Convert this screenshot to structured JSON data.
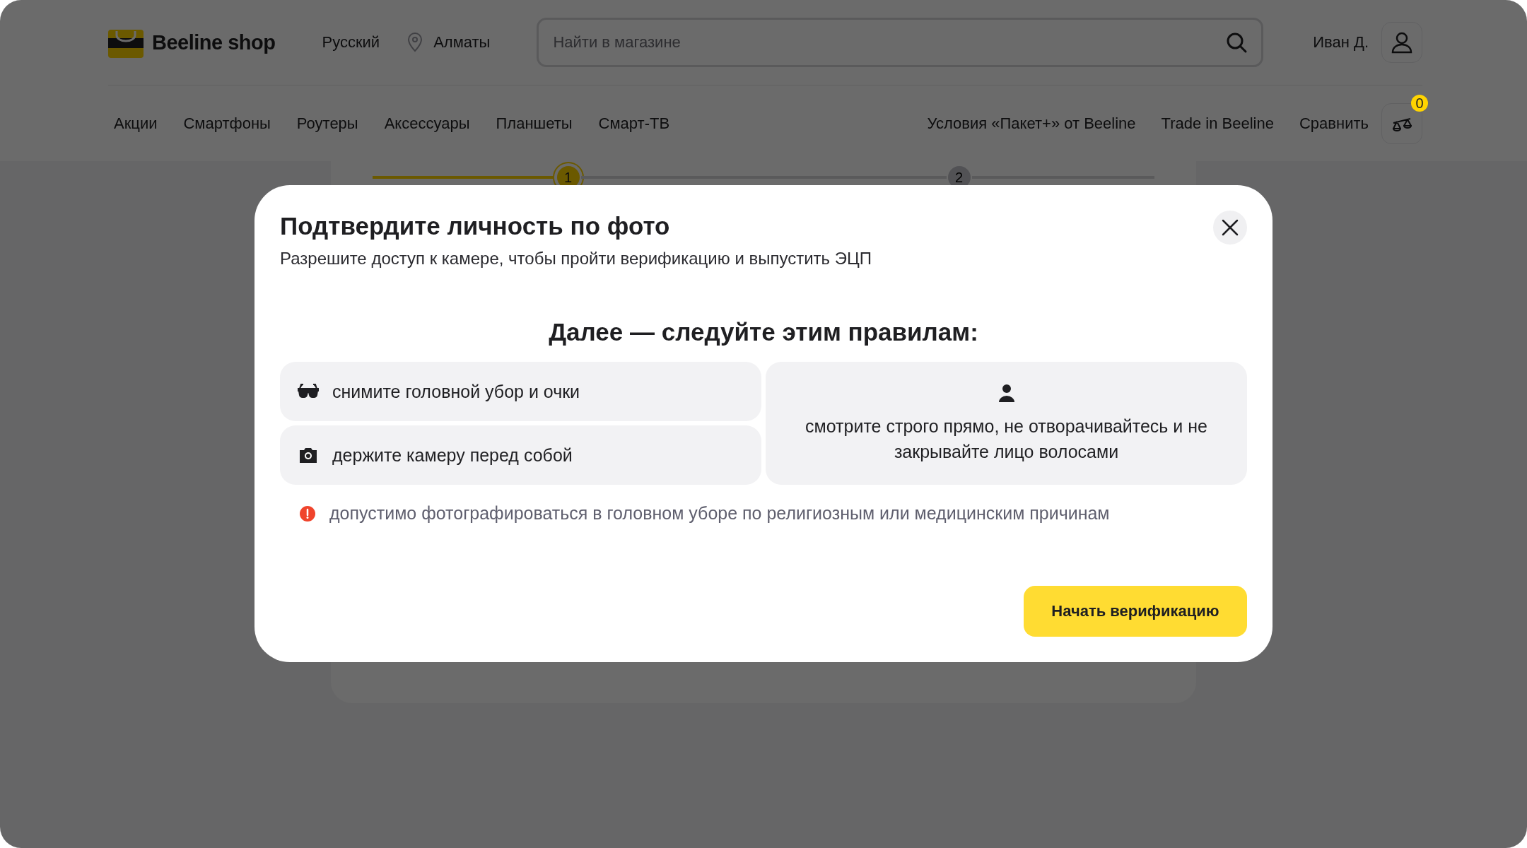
{
  "header": {
    "logo": "Beeline shop",
    "language": "Русский",
    "city": "Алматы",
    "search": {
      "placeholder": "Найти в магазине"
    },
    "user": "Иван Д."
  },
  "nav": {
    "items": [
      "Акции",
      "Смартфоны",
      "Роутеры",
      "Аксессуары",
      "Планшеты",
      "Смарт-ТВ"
    ],
    "right_items": [
      "Условия «Пакет+» от Beeline",
      "Trade in Beeline",
      "Сравнить"
    ],
    "compare_count": "0"
  },
  "stepper": {
    "steps": [
      {
        "label": "1",
        "selected": true
      },
      {
        "label": "2",
        "selected": false
      }
    ]
  },
  "modal": {
    "title": "Подтвердите личность по фото",
    "subtitle": "Разрешите доступ к камере, чтобы пройти верификацию и выпустить ЭЦП",
    "rules_heading": "Далее — следуйте этим правилам:",
    "rules": [
      {
        "kind": "glasses",
        "text": "снимите головной убор и очки"
      },
      {
        "kind": "camera",
        "text": "держите камеру перед собой"
      },
      {
        "kind": "face",
        "text": "смотрите строго прямо, не отворачивайтесь и не закрывайте лицо волосами"
      }
    ],
    "note": "допустимо фотографироваться в головном уборе по религиозным или медицинским причинам",
    "button": "Начать верификацию"
  }
}
